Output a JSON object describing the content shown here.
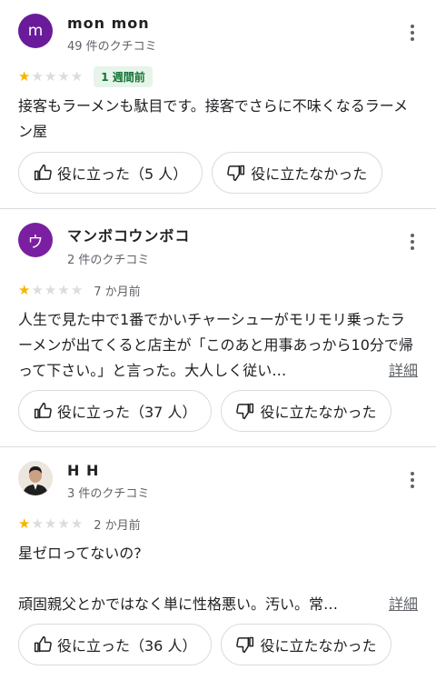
{
  "reviews": [
    {
      "name": "mon mon",
      "avatar_letter": "m",
      "avatar_color": "#6a1b9a",
      "review_count": "49 件のクチコミ",
      "stars": 1,
      "when": "1 週間前",
      "when_is_badge": true,
      "text": "接客もラーメンも駄目です。接客でさらに不味くなるラーメン屋",
      "more_label": "",
      "helpful_label": "役に立った（5 人）",
      "unhelpful_label": "役に立たなかった"
    },
    {
      "name": "マンボコウンボコ",
      "avatar_letter": "ウ",
      "avatar_color": "#7b1fa2",
      "review_count": "2 件のクチコミ",
      "stars": 1,
      "when": "7 か月前",
      "when_is_badge": false,
      "text": "人生で見た中で1番でかいチャーシューがモリモリ乗ったラーメンが出てくると店主が「このあと用事あっから10分で帰って下さい。」と言った。大人しく従い…",
      "more_label": "詳細",
      "helpful_label": "役に立った（37 人）",
      "unhelpful_label": "役に立たなかった"
    },
    {
      "name": "H H",
      "avatar_letter": "",
      "avatar_color": "#e9e4df",
      "review_count": "3 件のクチコミ",
      "stars": 1,
      "when": "2 か月前",
      "when_is_badge": false,
      "text_line1": "星ゼロってないの?",
      "text_line2": "頑固親父とかではなく単に性格悪い。汚い。常…",
      "more_label": "詳細",
      "helpful_label": "役に立った（36 人）",
      "unhelpful_label": "役に立たなかった"
    }
  ],
  "colors": {
    "star_on": "#f6b400",
    "star_off": "#dadce0",
    "badge_bg": "#e6f4ea",
    "badge_text": "#137333"
  }
}
